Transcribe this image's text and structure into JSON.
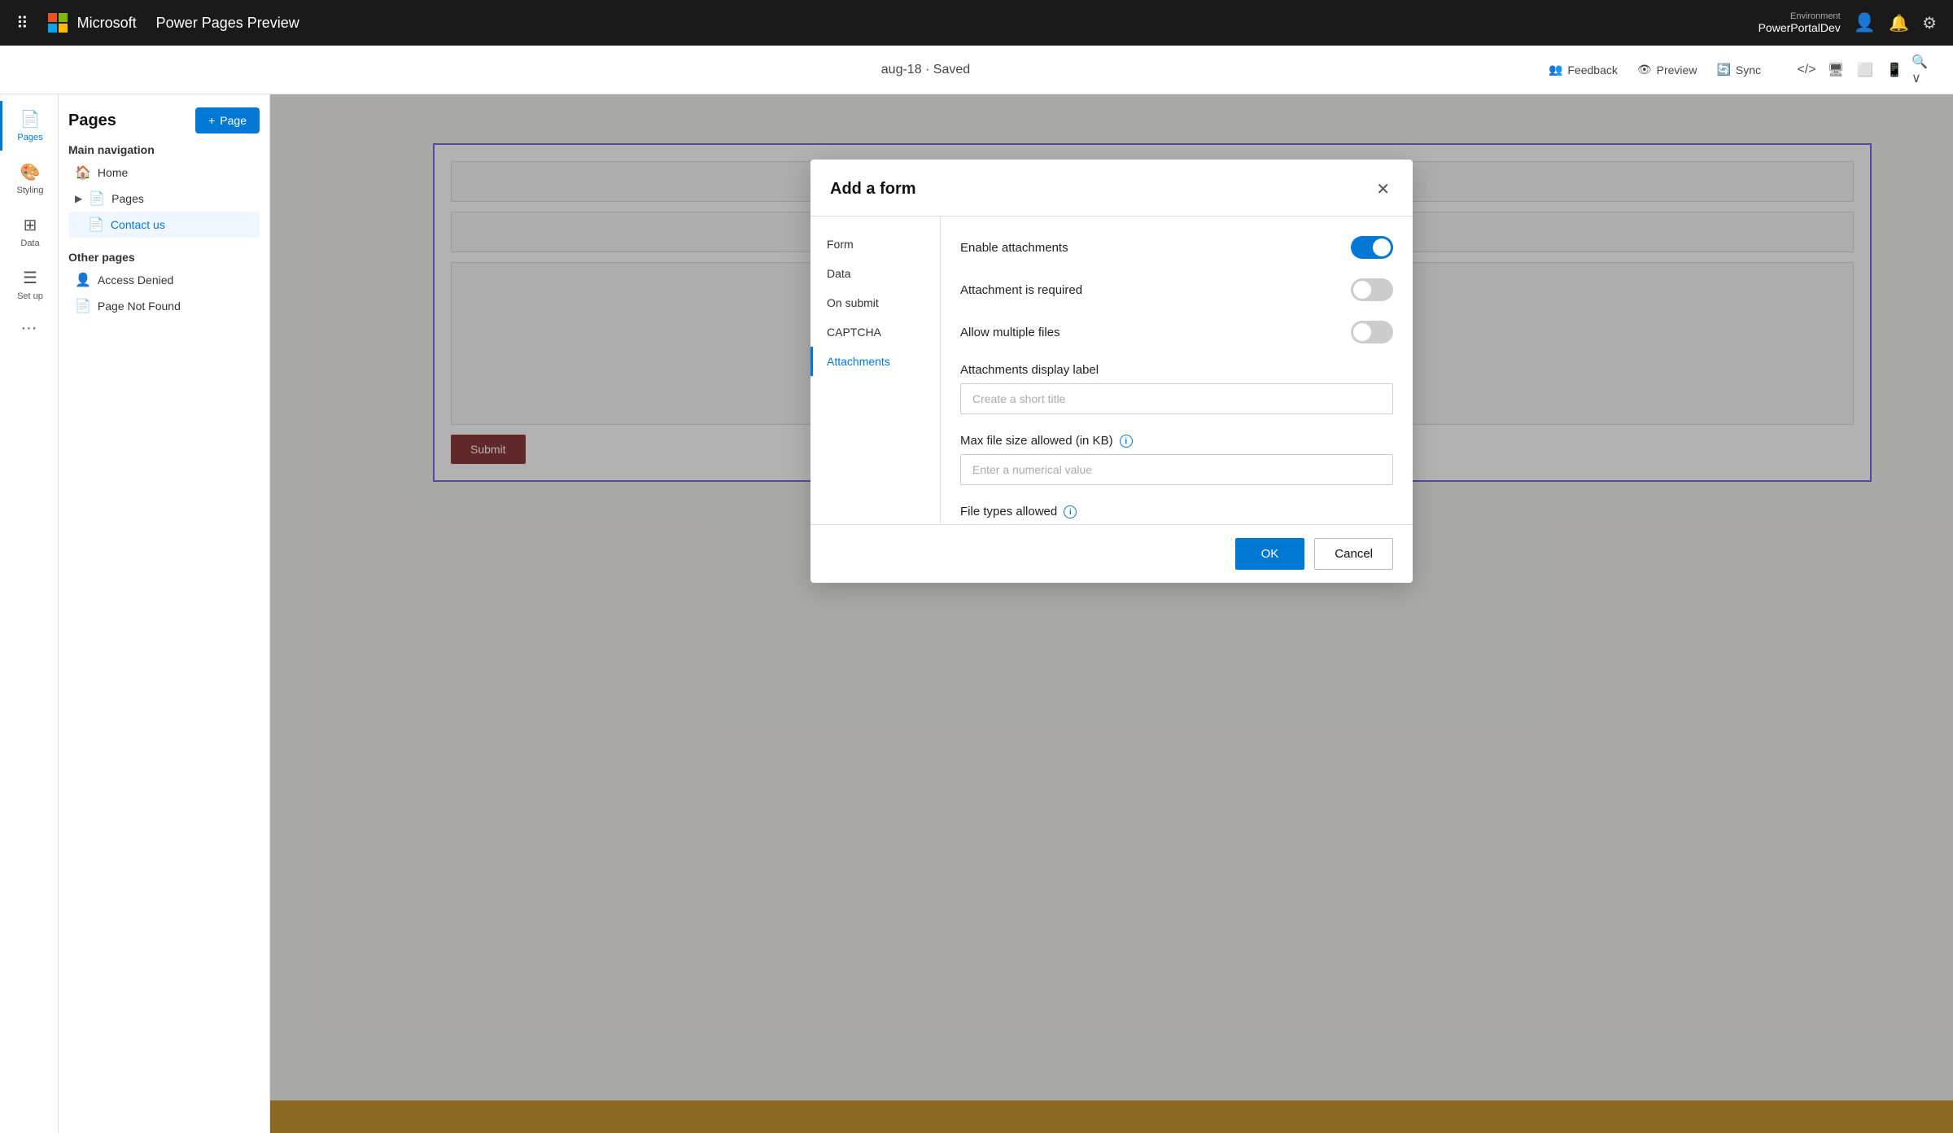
{
  "topbar": {
    "grid_icon": "⠿",
    "app_name": "Power Pages Preview",
    "env_label": "Environment",
    "env_name": "PowerPortalDev",
    "bell_icon": "🔔",
    "settings_icon": "⚙"
  },
  "secondbar": {
    "save_status": "aug-18 · Saved",
    "feedback_label": "Feedback",
    "preview_label": "Preview",
    "sync_label": "Sync"
  },
  "sidebar": {
    "items": [
      {
        "label": "Pages",
        "icon": "📄",
        "active": true
      },
      {
        "label": "Styling",
        "icon": "🎨",
        "active": false
      },
      {
        "label": "Data",
        "icon": "⊞",
        "active": false
      },
      {
        "label": "Set up",
        "icon": "☰",
        "active": false
      }
    ]
  },
  "pages_panel": {
    "title": "Pages",
    "add_button": "+ Page",
    "main_nav_label": "Main navigation",
    "main_nav_items": [
      {
        "label": "Home",
        "icon": "🏠",
        "active": false
      },
      {
        "label": "Pages",
        "icon": "📄",
        "active": false,
        "expandable": true
      },
      {
        "label": "Contact us",
        "icon": "📄",
        "active": true
      }
    ],
    "other_label": "Other pages",
    "other_items": [
      {
        "label": "Access Denied",
        "icon": "👤"
      },
      {
        "label": "Page Not Found",
        "icon": "📄"
      }
    ]
  },
  "modal": {
    "title": "Add a form",
    "close_icon": "✕",
    "nav_items": [
      {
        "label": "Form",
        "active": false
      },
      {
        "label": "Data",
        "active": false
      },
      {
        "label": "On submit",
        "active": false
      },
      {
        "label": "CAPTCHA",
        "active": false
      },
      {
        "label": "Attachments",
        "active": true
      }
    ],
    "attachments": {
      "enable_label": "Enable attachments",
      "enable_checked": true,
      "required_label": "Attachment is required",
      "required_checked": false,
      "multiple_label": "Allow multiple files",
      "multiple_checked": false,
      "display_label_heading": "Attachments display label",
      "display_label_placeholder": "Create a short title",
      "max_file_label": "Max file size allowed (in KB)",
      "max_file_placeholder": "Enter a numerical value",
      "file_types_label": "File types allowed"
    },
    "ok_button": "OK",
    "cancel_button": "Cancel"
  }
}
